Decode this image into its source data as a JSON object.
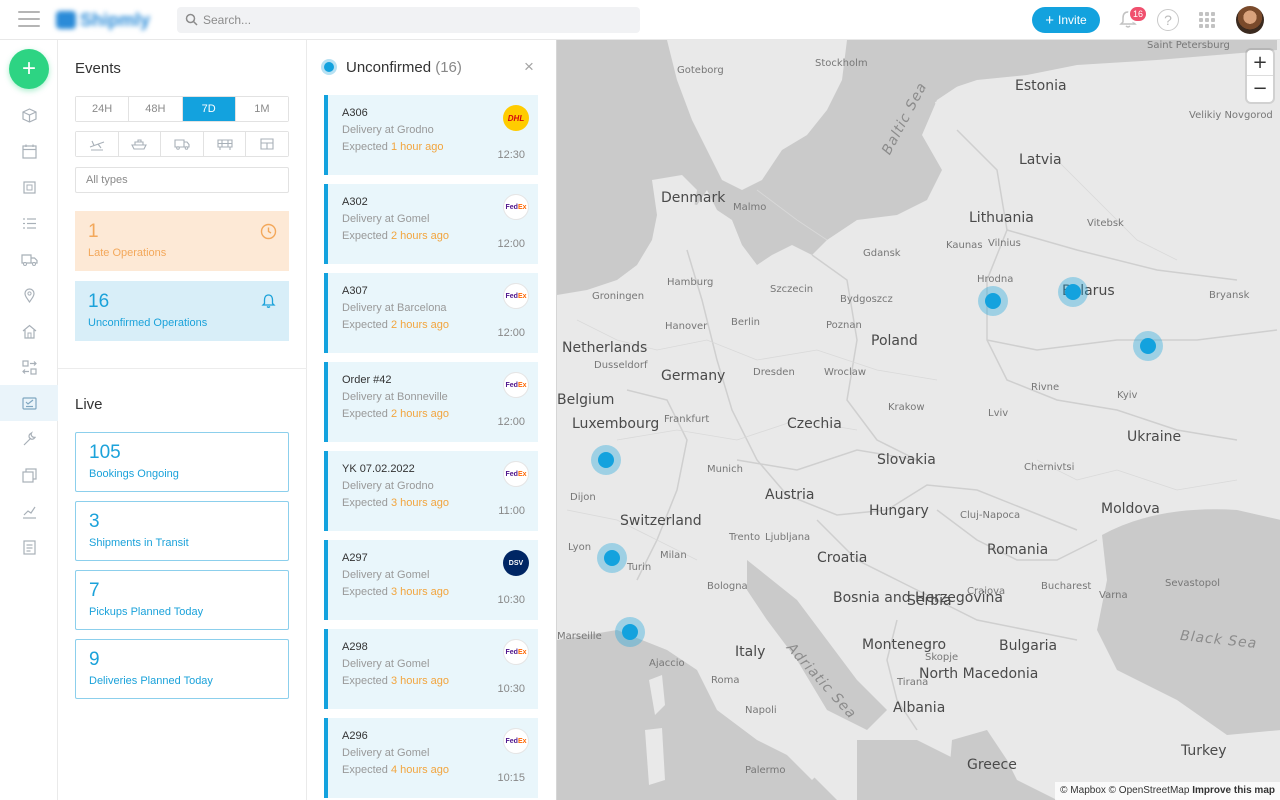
{
  "topbar": {
    "search_placeholder": "Search...",
    "invite_label": "Invite",
    "notifications_count": "16",
    "help_label": "?",
    "accent": "#13a2de",
    "badge_color": "#f0506e"
  },
  "rail": {
    "fab_label": "+",
    "fab_color": "#2dd483",
    "items": [
      "box-icon",
      "calendar-icon",
      "grid-icon",
      "list-icon",
      "truck-icon",
      "location-pin-icon",
      "home-icon",
      "transfer-icon",
      "operations-icon",
      "tools-icon",
      "documents-icon",
      "analytics-icon",
      "report-icon"
    ],
    "active_item": "operations-icon"
  },
  "events": {
    "title": "Events",
    "ranges": [
      "24H",
      "48H",
      "7D",
      "1M"
    ],
    "selected_range": "7D",
    "modes": [
      "plane-icon",
      "ship-icon",
      "truck-icon",
      "train-icon",
      "warehouse-icon"
    ],
    "types_placeholder": "All types",
    "late": {
      "count": "1",
      "label": "Late Operations",
      "color": "#f3a85b"
    },
    "unconfirmed": {
      "count": "16",
      "label": "Unconfirmed Operations",
      "color": "#1ba2da"
    }
  },
  "live": {
    "title": "Live",
    "cards": [
      {
        "count": "105",
        "label": "Bookings Ongoing"
      },
      {
        "count": "3",
        "label": "Shipments in Transit"
      },
      {
        "count": "7",
        "label": "Pickups Planned Today"
      },
      {
        "count": "9",
        "label": "Deliveries Planned Today"
      }
    ]
  },
  "unconfirmed_list": {
    "title": "Unconfirmed",
    "count": "(16)",
    "close_label": "×",
    "expected_prefix": "Expected",
    "items": [
      {
        "code": "A306",
        "location": "Delivery at Grodno",
        "ago": "1 hour ago",
        "time": "12:30",
        "carrier": "DHL"
      },
      {
        "code": "A302",
        "location": "Delivery at Gomel",
        "ago": "2 hours ago",
        "time": "12:00",
        "carrier": "FedEx"
      },
      {
        "code": "A307",
        "location": "Delivery at Barcelona",
        "ago": "2 hours ago",
        "time": "12:00",
        "carrier": "FedEx"
      },
      {
        "code": "Order #42",
        "location": "Delivery at Bonneville",
        "ago": "2 hours ago",
        "time": "12:00",
        "carrier": "FedEx"
      },
      {
        "code": "YK 07.02.2022",
        "location": "Delivery at Grodno",
        "ago": "3 hours ago",
        "time": "11:00",
        "carrier": "FedEx"
      },
      {
        "code": "A297",
        "location": "Delivery at Gomel",
        "ago": "3 hours ago",
        "time": "10:30",
        "carrier": "DSV"
      },
      {
        "code": "A298",
        "location": "Delivery at Gomel",
        "ago": "3 hours ago",
        "time": "10:30",
        "carrier": "FedEx"
      },
      {
        "code": "A296",
        "location": "Delivery at Gomel",
        "ago": "4 hours ago",
        "time": "10:15",
        "carrier": "FedEx"
      }
    ]
  },
  "map": {
    "zoom_in": "+",
    "zoom_out": "−",
    "attribution": "© Mapbox © OpenStreetMap",
    "improve_link": "Improve this map",
    "countries": [
      "Estonia",
      "Latvia",
      "Lithuania",
      "Belarus",
      "Poland",
      "Germany",
      "Denmark",
      "Netherlands",
      "Belgium",
      "Luxembourg",
      "Czechia",
      "Slovakia",
      "Austria",
      "Switzerland",
      "Hungary",
      "Romania",
      "Ukraine",
      "Moldova",
      "Croatia",
      "Bosnia and Herzegovina",
      "Serbia",
      "Montenegro",
      "Bulgaria",
      "Italy",
      "North Macedonia",
      "Albania",
      "Greece",
      "Turkey"
    ],
    "cities": [
      "Saint Petersburg",
      "Velikiy Novgorod",
      "Stockholm",
      "Goteborg",
      "Malmo",
      "Gdansk",
      "Hamburg",
      "Szczecin",
      "Bydgoszcz",
      "Berlin",
      "Poznan",
      "Hanover",
      "Groningen",
      "Dusseldorf",
      "Frankfurt",
      "Dresden",
      "Wroclaw",
      "Krakow",
      "Lviv",
      "Vilnius",
      "Kaunas",
      "Hrodna",
      "Vitebsk",
      "Bryansk",
      "Rivne",
      "Kyiv",
      "Chernivtsi",
      "Munich",
      "Trento",
      "Milan",
      "Turin",
      "Bologna",
      "Ljubljana",
      "Dijon",
      "Lyon",
      "Marseille",
      "Cluj-Napoca",
      "Bucharest",
      "Craiova",
      "Sevastopol",
      "Varna",
      "Skopje",
      "Tirana",
      "Napoli",
      "Palermo",
      "Ajaccio",
      "Roma"
    ],
    "seas": [
      "Baltic Sea",
      "Adriatic Sea",
      "Black Sea"
    ],
    "marker_color": "#13a2de"
  }
}
